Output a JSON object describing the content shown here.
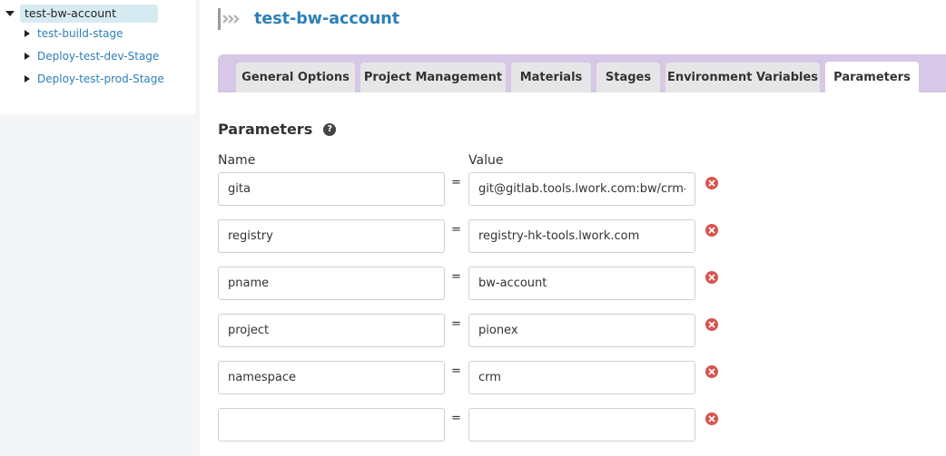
{
  "sidebar": {
    "root_label": "test-bw-account",
    "children": [
      {
        "label": "test-build-stage"
      },
      {
        "label": "Deploy-test-dev-Stage"
      },
      {
        "label": "Deploy-test-prod-Stage"
      }
    ]
  },
  "header": {
    "title": "test-bw-account"
  },
  "tabs": [
    {
      "label": "General Options"
    },
    {
      "label": "Project Management"
    },
    {
      "label": "Materials"
    },
    {
      "label": "Stages"
    },
    {
      "label": "Environment Variables"
    },
    {
      "label": "Parameters",
      "active": true
    }
  ],
  "section": {
    "title": "Parameters",
    "help_glyph": "?",
    "name_column": "Name",
    "value_column": "Value"
  },
  "parameters": [
    {
      "name": "gita",
      "value": "git@gitlab.tools.lwork.com:bw/crm-all"
    },
    {
      "name": "registry",
      "value": "registry-hk-tools.lwork.com"
    },
    {
      "name": "pname",
      "value": "bw-account"
    },
    {
      "name": "project",
      "value": "pionex"
    },
    {
      "name": "namespace",
      "value": "crm"
    },
    {
      "name": "",
      "value": ""
    }
  ],
  "separator": "=",
  "colors": {
    "link": "#2c7fb8",
    "tab_bar": "#d6c8e6",
    "remove": "#d9534f",
    "tree_selected": "#d5ebf1"
  },
  "icons": {
    "breadcrumb": "chevron-steps-icon",
    "help": "question-circle-icon",
    "remove": "remove-circle-icon",
    "tree_expanded": "caret-down-icon",
    "tree_collapsed": "caret-right-icon"
  }
}
